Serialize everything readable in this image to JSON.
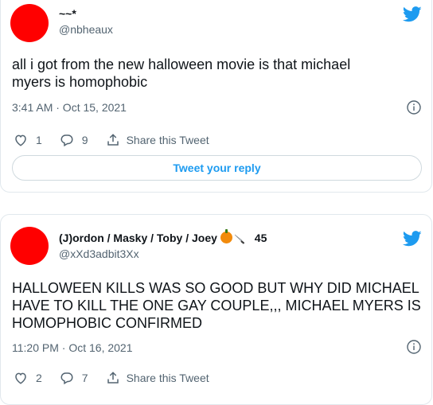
{
  "colors": {
    "accent": "#1d9bf0",
    "muted": "#536471",
    "avatar": "#ff0000"
  },
  "tweets": [
    {
      "name": "~~*",
      "handle": "@nbheaux",
      "text": "all i got from the new halloween movie is that michael\nmyers is homophobic",
      "timestamp": "3:41 AM · Oct 15, 2021",
      "like_count": "1",
      "reply_count": "9",
      "share_label": "Share this Tweet",
      "reply_button_label": "Tweet your reply"
    },
    {
      "name": "(J)ordon / Masky / Toby / Joey",
      "name_emojis": [
        "pumpkin-emoji",
        "knife-emoji"
      ],
      "name_suffix": "45",
      "handle": "@xXd3adbit3Xx",
      "text": "HALLOWEEN KILLS WAS SO GOOD BUT WHY DID MICHAEL\nHAVE TO KILL THE ONE GAY COUPLE,,, MICHAEL MYERS IS\nHOMOPHOBIC CONFIRMED",
      "timestamp": "11:20 PM · Oct 16, 2021",
      "like_count": "2",
      "reply_count": "7",
      "share_label": "Share this Tweet"
    }
  ]
}
